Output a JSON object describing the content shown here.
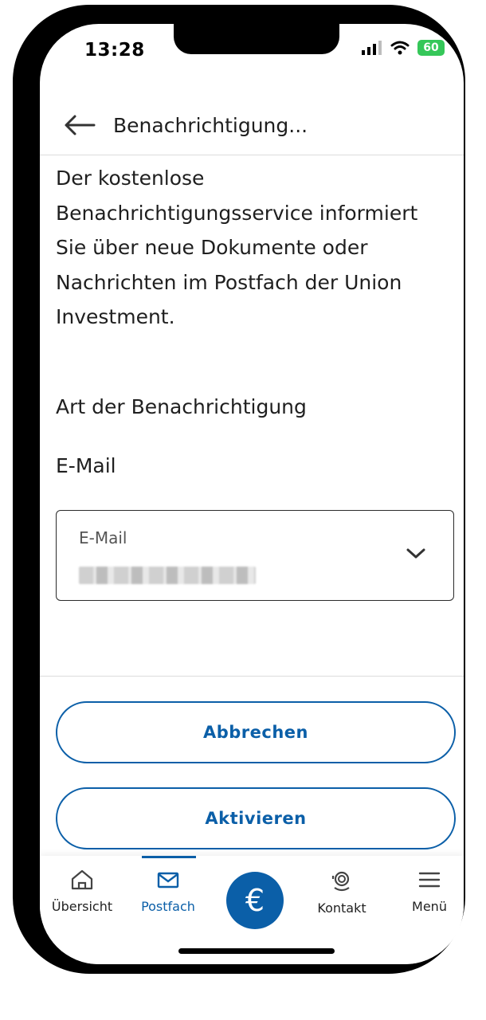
{
  "status_bar": {
    "time": "13:28",
    "battery": "60"
  },
  "header": {
    "title": "Benachrichtigung..."
  },
  "content": {
    "intro_lines": [
      "Der kostenlose",
      "Benachrichtigungsservice informiert",
      "Sie über neue Dokumente oder",
      "Nachrichten im Postfach der Union",
      "Investment."
    ],
    "notification_type_label": "Art der Benachrichtigung",
    "channel_label": "E-Mail",
    "email_field": {
      "label": "E-Mail"
    }
  },
  "actions": {
    "cancel": "Abbrechen",
    "activate": "Aktivieren"
  },
  "nav": {
    "items": [
      {
        "label": "Übersicht",
        "icon": "home-icon"
      },
      {
        "label": "Postfach",
        "icon": "mail-icon",
        "active": true
      },
      {
        "label": "",
        "icon": "euro-icon"
      },
      {
        "label": "Kontakt",
        "icon": "headset-icon"
      },
      {
        "label": "Menü",
        "icon": "menu-icon"
      }
    ]
  },
  "colors": {
    "accent": "#0b5fa8",
    "battery": "#35c759"
  }
}
